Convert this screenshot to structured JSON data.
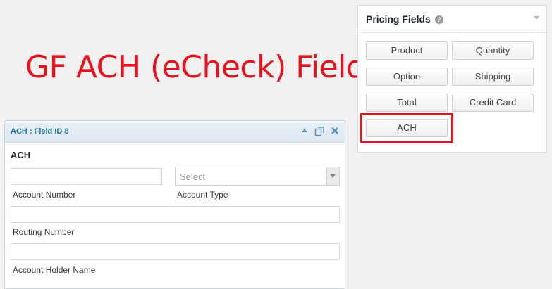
{
  "headline": "GF ACH (eCheck) Field",
  "pricing_panel": {
    "title": "Pricing Fields",
    "help_glyph": "?",
    "buttons": {
      "product": "Product",
      "quantity": "Quantity",
      "option": "Option",
      "shipping": "Shipping",
      "total": "Total",
      "credit_card": "Credit Card",
      "ach": "ACH"
    }
  },
  "ach_field": {
    "header_title": "ACH : Field ID 8",
    "field_label": "ACH",
    "account_number_label": "Account Number",
    "account_type_label": "Account Type",
    "account_type_value": "Select",
    "routing_number_label": "Routing Number",
    "account_holder_label": "Account Holder Name"
  },
  "colors": {
    "highlight": "#e8121c",
    "header_link": "#21759b"
  },
  "icons": [
    "help-icon",
    "chevron-down-icon",
    "collapse-arrow-icon",
    "duplicate-icon",
    "close-icon"
  ]
}
